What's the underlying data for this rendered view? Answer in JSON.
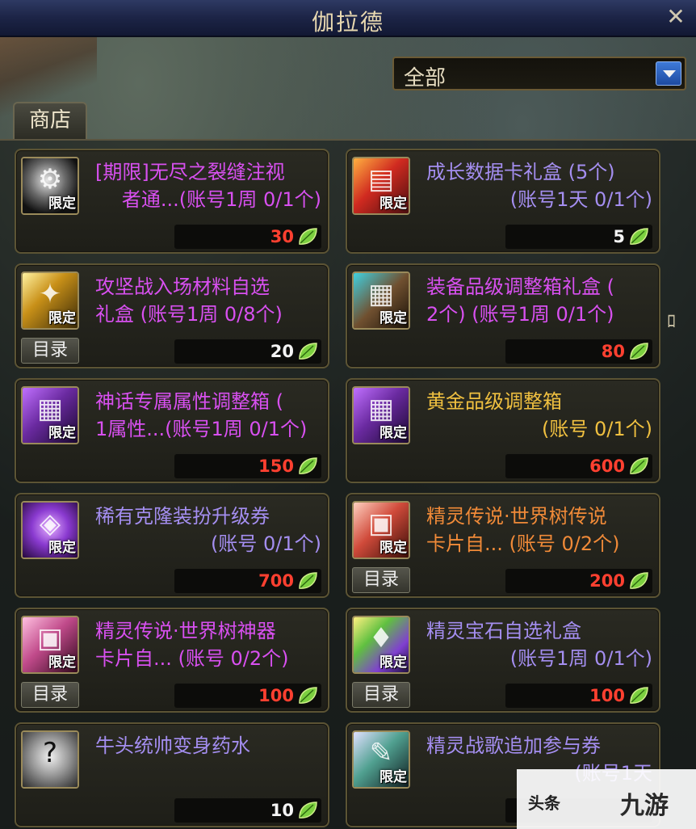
{
  "window": {
    "title": "伽拉德"
  },
  "icons": {
    "close": "close-icon",
    "dropdown_arrow": "chevron-down-icon",
    "currency": "leaf-currency-icon"
  },
  "filter": {
    "selected": "全部"
  },
  "tab": {
    "label": "商店"
  },
  "colors": {
    "purple": "#d850f0",
    "lavender": "#a48ef0",
    "gold": "#f0c040",
    "orange": "#f08a38",
    "price_red": "#ff4030",
    "price_white": "#f4f4f4"
  },
  "items": [
    {
      "line1": "[期限]无尽之裂缝注视",
      "line2": "者通...(账号1周 0/1个)",
      "price": "30",
      "badge": "限定",
      "catalog": ""
    },
    {
      "line1": "成长数据卡礼盒 (5个)",
      "line2": "(账号1天 0/1个)",
      "price": "5",
      "badge": "限定",
      "catalog": ""
    },
    {
      "line1": "攻坚战入场材料自选",
      "line2": "礼盒 (账号1周 0/8个)",
      "price": "20",
      "badge": "限定",
      "catalog": "目录"
    },
    {
      "line1": "装备品级调整箱礼盒 (",
      "line2": "2个) (账号1周 0/1个)",
      "price": "80",
      "badge": "限定",
      "catalog": ""
    },
    {
      "line1": "神话专属属性调整箱 (",
      "line2": "1属性...(账号1周 0/1个)",
      "price": "150",
      "badge": "限定",
      "catalog": ""
    },
    {
      "line1": "黄金品级调整箱",
      "line2": "(账号 0/1个)",
      "price": "600",
      "badge": "限定",
      "catalog": ""
    },
    {
      "line1": "稀有克隆装扮升级券",
      "line2": "(账号 0/1个)",
      "price": "700",
      "badge": "限定",
      "catalog": ""
    },
    {
      "line1": "精灵传说·世界树传说",
      "line2": "卡片自... (账号 0/2个)",
      "price": "200",
      "badge": "限定",
      "catalog": "目录"
    },
    {
      "line1": "精灵传说·世界树神器",
      "line2": "卡片自... (账号 0/2个)",
      "price": "100",
      "badge": "限定",
      "catalog": "目录"
    },
    {
      "line1": "精灵宝石自选礼盒",
      "line2": "(账号1周 0/1个)",
      "price": "100",
      "badge": "限定",
      "catalog": "目录"
    },
    {
      "line1": "牛头统帅变身药水",
      "line2": "",
      "price": "10",
      "badge": "",
      "catalog": ""
    },
    {
      "line1": "精灵战歌追加参与券",
      "line2": "(账号1天",
      "price": "",
      "badge": "限定",
      "catalog": ""
    }
  ],
  "watermark": {
    "left_text": "头条",
    "logo_text": "九游"
  }
}
